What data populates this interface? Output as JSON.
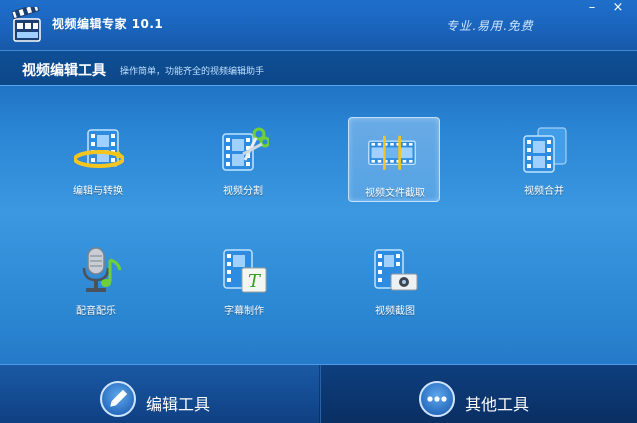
{
  "window": {
    "title": "视频编辑专家 10.1",
    "slogan": "专业.易用.免费",
    "minimize_glyph": "–",
    "close_glyph": "×"
  },
  "section": {
    "title": "视频编辑工具",
    "subtitle": "操作简单，功能齐全的视频编辑助手"
  },
  "tools": [
    {
      "label": "编辑与转换",
      "icon": "film-convert-icon",
      "selected": false
    },
    {
      "label": "视频分割",
      "icon": "film-scissors-icon",
      "selected": false
    },
    {
      "label": "视频文件截取",
      "icon": "film-trim-icon",
      "selected": true
    },
    {
      "label": "视频合并",
      "icon": "film-merge-icon",
      "selected": false
    },
    {
      "label": "配音配乐",
      "icon": "microphone-music-icon",
      "selected": false
    },
    {
      "label": "字幕制作",
      "icon": "film-subtitle-icon",
      "selected": false
    },
    {
      "label": "视频截图",
      "icon": "film-camera-icon",
      "selected": false
    }
  ],
  "bottom_tabs": [
    {
      "label": "编辑工具",
      "icon": "pencil-icon",
      "active": true
    },
    {
      "label": "其他工具",
      "icon": "more-dots-icon",
      "active": false
    }
  ],
  "colors": {
    "accent": "#1e6fcb",
    "film_blue": "#2d8be0",
    "highlight": "#ffffff"
  }
}
